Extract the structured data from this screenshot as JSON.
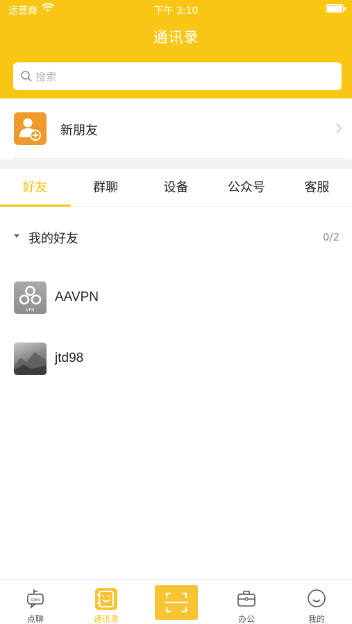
{
  "status_bar": {
    "carrier": "运营商",
    "time": "下午 3:10"
  },
  "header": {
    "title": "通讯录",
    "search_placeholder": "搜索"
  },
  "new_friends": {
    "label": "新朋友",
    "icon": "add-user-icon"
  },
  "tabs": [
    {
      "label": "好友",
      "active": true
    },
    {
      "label": "群聊",
      "active": false
    },
    {
      "label": "设备",
      "active": false
    },
    {
      "label": "公众号",
      "active": false
    },
    {
      "label": "客服",
      "active": false
    }
  ],
  "group": {
    "title": "我的好友",
    "count": "0/2"
  },
  "friends": [
    {
      "name": "AAVPN",
      "avatar": "vpn-avatar",
      "avatar_caption": "VPN"
    },
    {
      "name": "jtd98",
      "avatar": "photo-avatar"
    }
  ],
  "tabbar": {
    "items": [
      {
        "label": "点聊",
        "icon": "chat-icon",
        "active": false
      },
      {
        "label": "通讯录",
        "icon": "contacts-icon",
        "active": true
      },
      {
        "label": "",
        "icon": "scan-icon",
        "active": false
      },
      {
        "label": "办公",
        "icon": "briefcase-icon",
        "active": false
      },
      {
        "label": "我的",
        "icon": "profile-icon",
        "active": false
      }
    ],
    "chat_icon_text": "QIAN"
  },
  "colors": {
    "brand": "#f9c713",
    "accent": "#f5c20e",
    "new_friend_icon_bg": "#ef9a2d"
  }
}
